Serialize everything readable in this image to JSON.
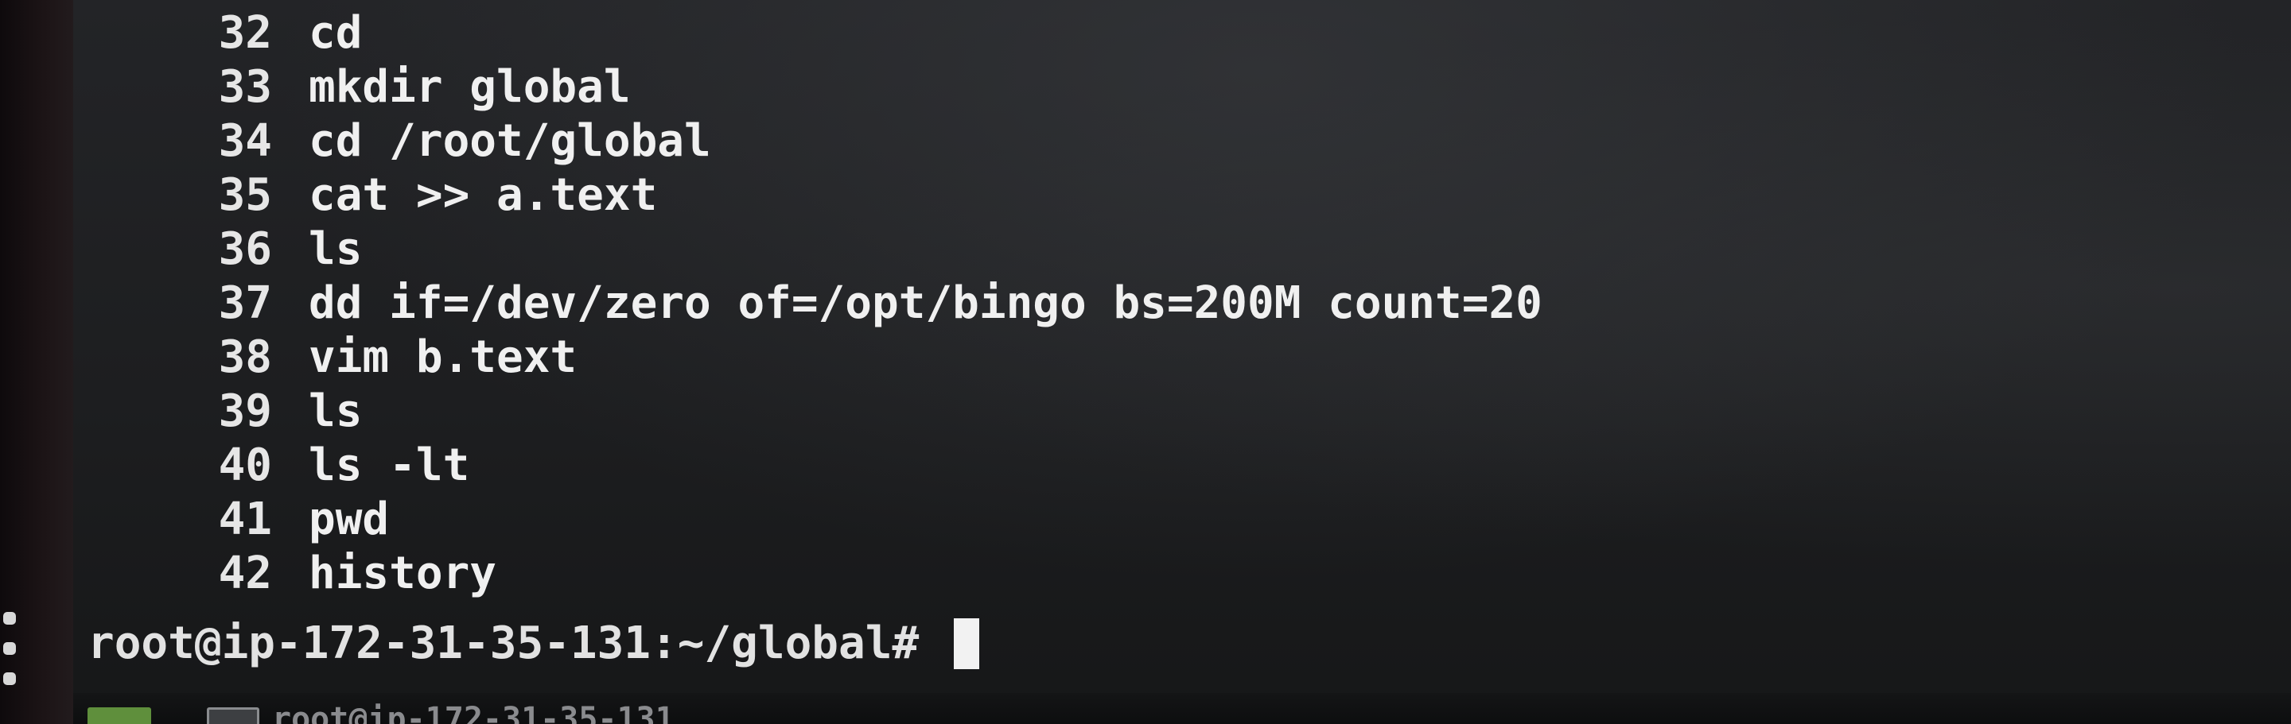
{
  "history": [
    {
      "num": "32",
      "cmd": "cd"
    },
    {
      "num": "33",
      "cmd": "mkdir global"
    },
    {
      "num": "34",
      "cmd": "cd /root/global"
    },
    {
      "num": "35",
      "cmd": "cat >> a.text"
    },
    {
      "num": "36",
      "cmd": "ls"
    },
    {
      "num": "37",
      "cmd": "dd if=/dev/zero of=/opt/bingo bs=200M count=20"
    },
    {
      "num": "38",
      "cmd": "vim b.text"
    },
    {
      "num": "39",
      "cmd": "ls"
    },
    {
      "num": "40",
      "cmd": "ls -lt"
    },
    {
      "num": "41",
      "cmd": "pwd"
    },
    {
      "num": "42",
      "cmd": "history"
    }
  ],
  "prompt": "root@ip-172-31-35-131:~/global#",
  "taskbar": {
    "window_label": "root@ip-172-31-35-131",
    "icons": [
      "app-launcher-icon",
      "terminal-icon"
    ]
  },
  "colors": {
    "background": "#1d1e20",
    "text": "#eaeaea",
    "cursor": "#f2f2f2"
  }
}
